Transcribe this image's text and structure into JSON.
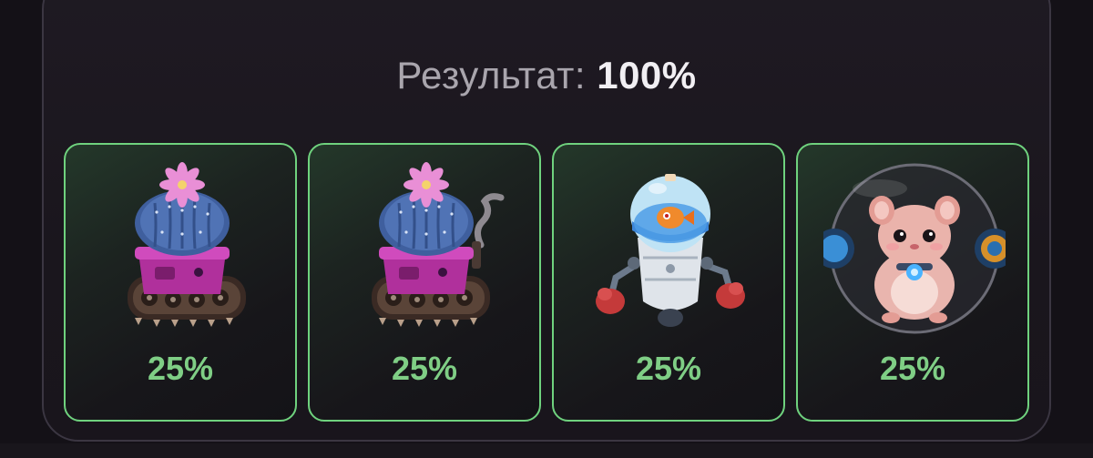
{
  "result": {
    "label": "Результат:",
    "value": "100%"
  },
  "cards": [
    {
      "item": "cactus-tank",
      "percent": "25%"
    },
    {
      "item": "cactus-tank-smoking",
      "percent": "25%"
    },
    {
      "item": "fishbowl-robot",
      "percent": "25%"
    },
    {
      "item": "hamster-ball",
      "percent": "25%"
    }
  ],
  "colors": {
    "accent_green": "#6fd27e",
    "percent_text": "#7fce85",
    "label_text": "#a9a5ad",
    "value_text": "#f1eff3",
    "background": "#141117"
  }
}
